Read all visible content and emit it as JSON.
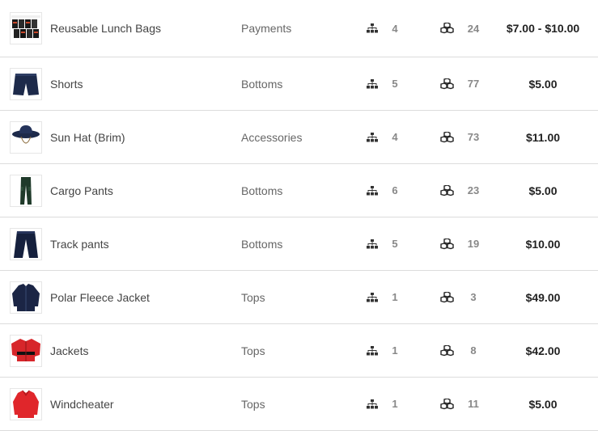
{
  "products": [
    {
      "name": "Reusable Lunch Bags",
      "category": "Payments",
      "variants": "4",
      "stock": "24",
      "price": "$7.00 - $10.00",
      "image_icon": "lunch-bags-icon"
    },
    {
      "name": "Shorts",
      "category": "Bottoms",
      "variants": "5",
      "stock": "77",
      "price": "$5.00",
      "image_icon": "shorts-icon"
    },
    {
      "name": "Sun Hat (Brim)",
      "category": "Accessories",
      "variants": "4",
      "stock": "73",
      "price": "$11.00",
      "image_icon": "sun-hat-icon"
    },
    {
      "name": "Cargo Pants",
      "category": "Bottoms",
      "variants": "6",
      "stock": "23",
      "price": "$5.00",
      "image_icon": "cargo-pants-icon"
    },
    {
      "name": "Track pants",
      "category": "Bottoms",
      "variants": "5",
      "stock": "19",
      "price": "$10.00",
      "image_icon": "track-pants-icon"
    },
    {
      "name": "Polar Fleece Jacket",
      "category": "Tops",
      "variants": "1",
      "stock": "3",
      "price": "$49.00",
      "image_icon": "fleece-jacket-icon"
    },
    {
      "name": "Jackets",
      "category": "Tops",
      "variants": "1",
      "stock": "8",
      "price": "$42.00",
      "image_icon": "jacket-icon"
    },
    {
      "name": "Windcheater",
      "category": "Tops",
      "variants": "1",
      "stock": "11",
      "price": "$5.00",
      "image_icon": "windcheater-icon"
    }
  ],
  "icons": {
    "variants": "sitemap-icon",
    "stock": "cubes-icon"
  },
  "colors": {
    "navy": "#1d2a4a",
    "dark_green": "#1f3a2a",
    "red": "#d7262a",
    "text": "#444444",
    "price": "#222222",
    "border": "#dcdcdc"
  }
}
